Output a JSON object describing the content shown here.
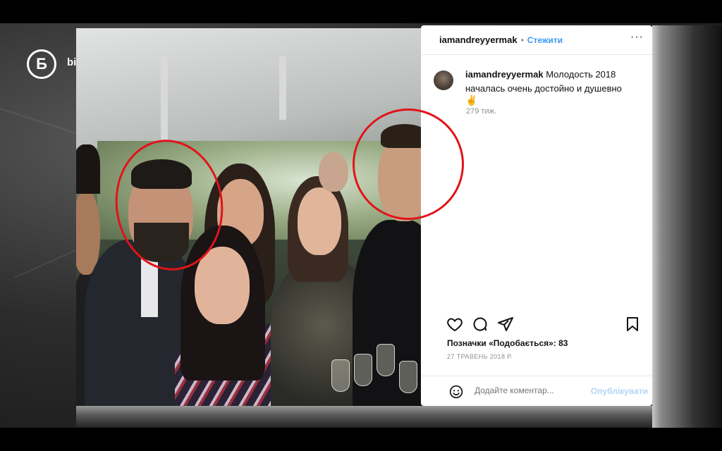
{
  "brand": {
    "logo_letter": "Б",
    "name": "bihus"
  },
  "post": {
    "username": "iamandreyyermak",
    "separator": "•",
    "follow_label": "Стежити",
    "more_label": "···",
    "caption_user": "iamandreyyermak",
    "caption_text": "Молодость 2018 началась очень достойно и душевно",
    "caption_emoji": "✌",
    "age": "279 тиж.",
    "likes_text": "Позначки «Подобається»: 83",
    "date": "27 ТРАВЕНЬ 2018 Р.",
    "comment_placeholder": "Додайте коментар...",
    "post_button": "Опублікувати"
  },
  "colors": {
    "highlight_circle": "#e0141a",
    "follow_blue": "#3897f0"
  },
  "icons": [
    "heart-icon",
    "comment-icon",
    "share-icon",
    "bookmark-icon",
    "emoji-icon",
    "more-icon"
  ]
}
